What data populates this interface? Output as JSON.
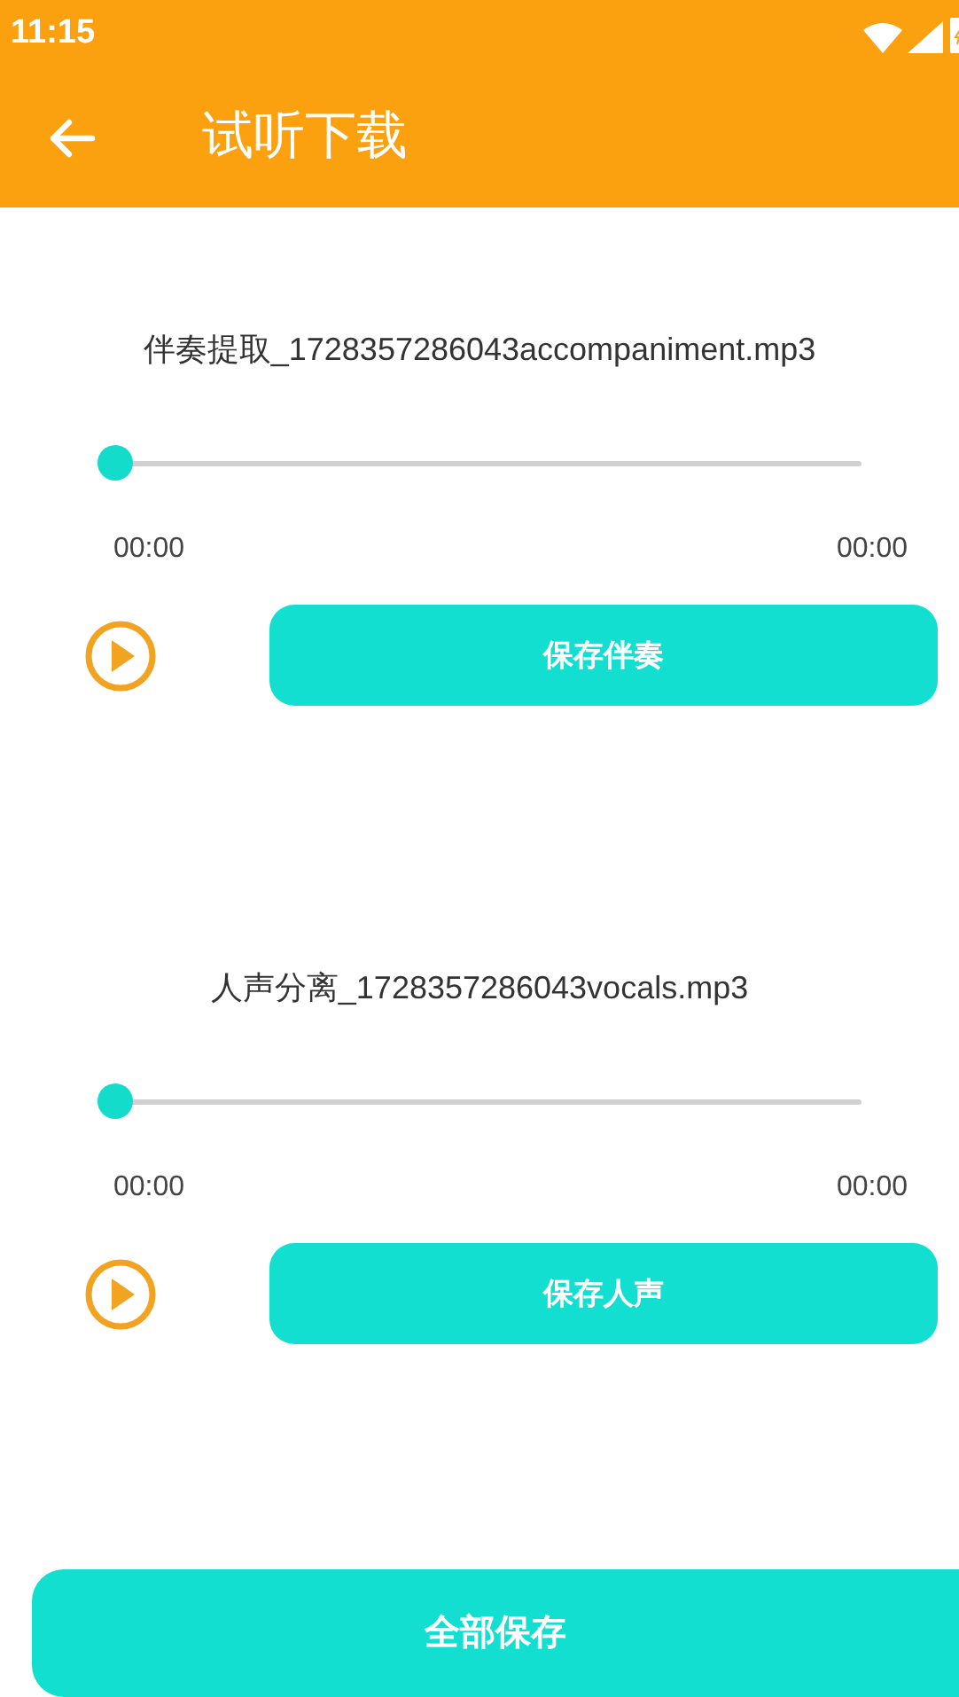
{
  "status_bar": {
    "time": "11:15"
  },
  "app_bar": {
    "title": "试听下载"
  },
  "tracks": [
    {
      "file_name": "伴奏提取_1728357286043accompaniment.mp3",
      "level": 0,
      "elapsed": "00:00",
      "duration": "00:00",
      "save_label": "保存伴奏"
    },
    {
      "file_name": "人声分离_1728357286043vocals.mp3",
      "level": 0,
      "elapsed": "00:00",
      "duration": "00:00",
      "save_label": "保存人声"
    }
  ],
  "save_all_label": "全部保存"
}
